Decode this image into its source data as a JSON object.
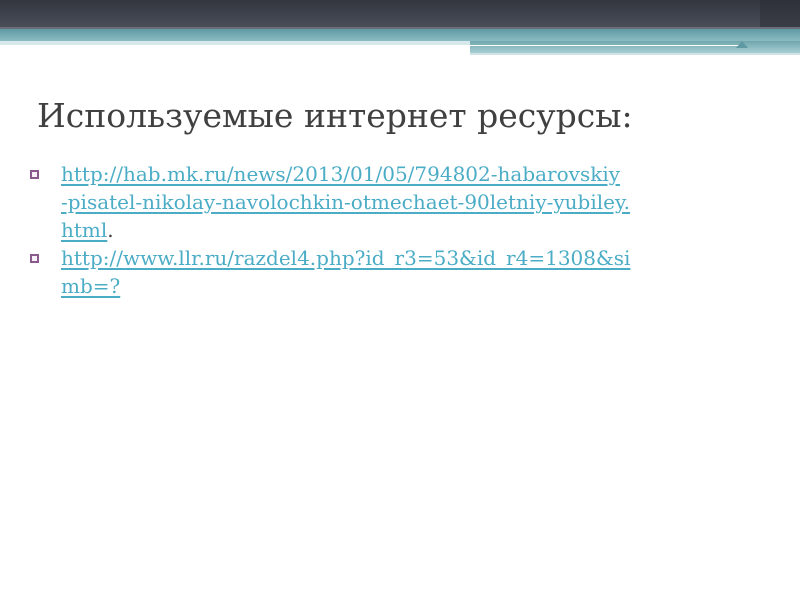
{
  "slide": {
    "title": "Используемые интернет ресурсы:",
    "items": [
      {
        "lines": [
          "http://hab.mk.ru/news/2013/01/05/794802-habarovskiy",
          "-pisatel-nikolay-navolochkin-otmechaet-90letniy-yubiley.",
          "html"
        ],
        "trailing": "."
      },
      {
        "lines": [
          "http://www.llr.ru/razdel4.php?id_r3=53&id_r4=1308&si",
          "mb=?"
        ],
        "trailing": ""
      }
    ]
  },
  "colors": {
    "link": "#4bacc6",
    "title": "#404040",
    "bullet": "#8a5a8e",
    "header_dark": "#3f434d",
    "header_teal": "#5f9aa4"
  }
}
